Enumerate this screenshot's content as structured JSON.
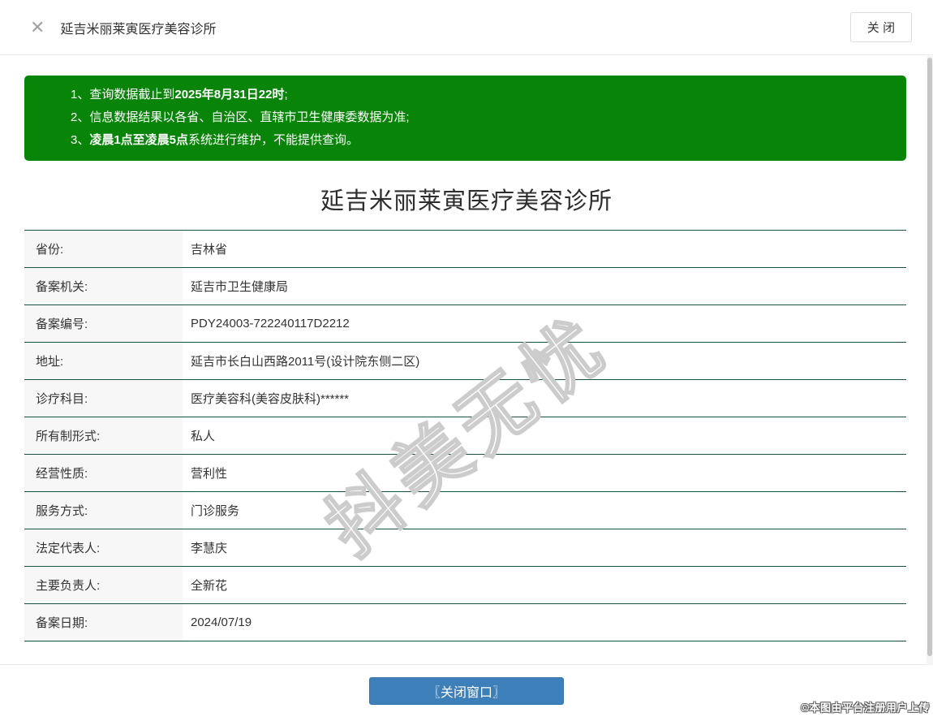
{
  "header": {
    "close_icon": "✕",
    "title": "延吉米丽莱寅医疗美容诊所",
    "close_button": "关 闭"
  },
  "notice": {
    "lines": [
      {
        "num": "1、",
        "pre": "查询数据截止到",
        "bold": "2025年8月31日22时",
        "post": ";"
      },
      {
        "num": "2、",
        "pre": "信息数据结果以各省、自治区、直辖市卫生健康委数据为准;",
        "bold": "",
        "post": ""
      },
      {
        "num": "3、",
        "pre": "",
        "bold": "凌晨1点至凌晨5点",
        "post": "系统进行维护，不能提供查询。"
      }
    ]
  },
  "main": {
    "title": "延吉米丽莱寅医疗美容诊所"
  },
  "table": {
    "rows": [
      {
        "label": "省份:",
        "value": "吉林省"
      },
      {
        "label": "备案机关:",
        "value": "延吉市卫生健康局"
      },
      {
        "label": "备案编号:",
        "value": "PDY24003-722240117D2212"
      },
      {
        "label": "地址:",
        "value": "延吉市长白山西路2011号(设计院东侧二区)"
      },
      {
        "label": "诊疗科目:",
        "value": "医疗美容科(美容皮肤科)******"
      },
      {
        "label": "所有制形式:",
        "value": "私人"
      },
      {
        "label": "经营性质:",
        "value": "营利性"
      },
      {
        "label": "服务方式:",
        "value": "门诊服务"
      },
      {
        "label": "法定代表人:",
        "value": "李慧庆"
      },
      {
        "label": "主要负责人:",
        "value": "全新花"
      },
      {
        "label": "备案日期:",
        "value": "2024/07/19"
      }
    ]
  },
  "watermark": "抖美无忧",
  "footer": {
    "close_window_button": "〖关闭窗口〗"
  },
  "copyright": "©本图由平台注册用户上传",
  "colors": {
    "notice_bg": "#088408",
    "table_border": "#1a5245",
    "button_bg": "#3d7fb8",
    "label_bg": "#f7f7f7"
  }
}
